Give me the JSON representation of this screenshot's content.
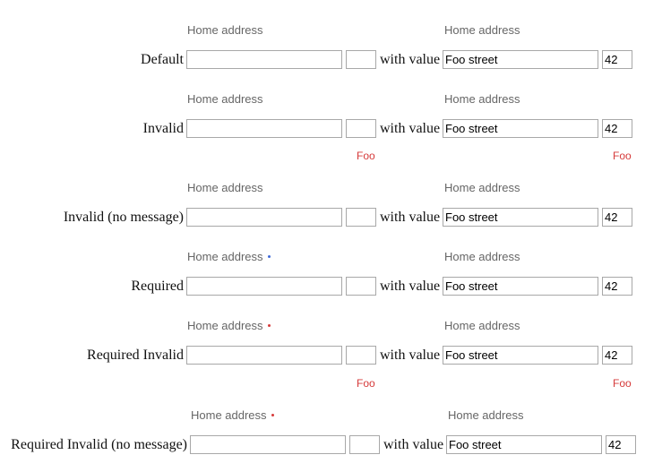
{
  "field_label": "Home address",
  "with_value_text": "with value",
  "street_value": "Foo street",
  "number_value": "42",
  "error_message": "Foo",
  "colors": {
    "label": "#666666",
    "error": "#d63a3a",
    "required_default": "#3f6ad8",
    "required_invalid": "#d63a3a",
    "input_border": "#a8a8a8"
  },
  "rows": [
    {
      "label": "Default"
    },
    {
      "label": "Invalid"
    },
    {
      "label": "Invalid (no message)"
    },
    {
      "label": "Required"
    },
    {
      "label": "Required Invalid"
    },
    {
      "label": "Required Invalid (no message)"
    }
  ]
}
